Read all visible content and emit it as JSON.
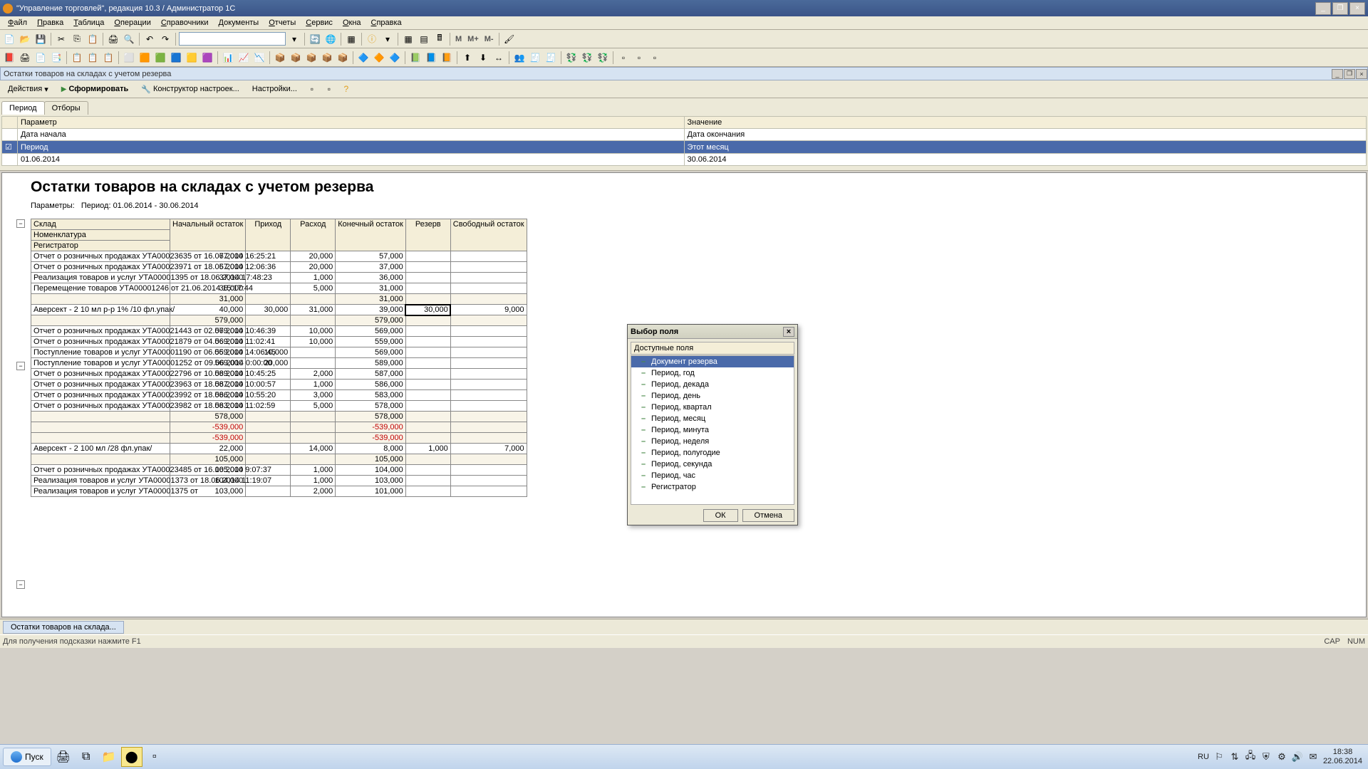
{
  "title": "\"Управление торговлей\", редакция 10.3 / Администратор 1С",
  "menu": [
    "Файл",
    "Правка",
    "Таблица",
    "Операции",
    "Справочники",
    "Документы",
    "Отчеты",
    "Сервис",
    "Окна",
    "Справка"
  ],
  "document_tab": "Остатки товаров на складах с учетом резерва",
  "actionbar": {
    "actions": "Действия",
    "run": "Сформировать",
    "constructor": "Конструктор настроек...",
    "settings": "Настройки..."
  },
  "tabs": [
    "Период",
    "Отборы"
  ],
  "param_headers": {
    "p": "Параметр",
    "v": "Значение"
  },
  "param_rows": [
    {
      "p": "Дата начала",
      "v": "Дата окончания",
      "chk": false
    },
    {
      "p": "Период",
      "v": "Этот месяц",
      "chk": true,
      "sel": true
    },
    {
      "p": "01.06.2014",
      "v": "30.06.2014",
      "chk": false
    }
  ],
  "report": {
    "title": "Остатки товаров на складах с учетом резерва",
    "params_label": "Параметры:",
    "params_value": "Период: 01.06.2014 - 30.06.2014",
    "cols": [
      "Склад",
      "Начальный остаток",
      "Приход",
      "Расход",
      "Конечный остаток",
      "Резерв",
      "Свободный остаток"
    ],
    "sub": [
      "Номенклатура",
      "Регистратор"
    ],
    "rows": [
      {
        "n": "Отчет о розничных продажах УТА00023635 от 16.06.2014 16:25:21",
        "c": [
          "77,000",
          "",
          "20,000",
          "57,000",
          "",
          ""
        ]
      },
      {
        "n": "Отчет о розничных продажах УТА00023971 от 18.06.2014 12:06:36",
        "c": [
          "57,000",
          "",
          "20,000",
          "37,000",
          "",
          ""
        ]
      },
      {
        "n": "Реализация товаров и услуг УТА00001395 от 18.06.2014 17:48:23",
        "c": [
          "37,000",
          "",
          "1,000",
          "36,000",
          "",
          ""
        ]
      },
      {
        "n": "Перемещение товаров УТА00001246 от 21.06.2014 15:17:44",
        "c": [
          "36,000",
          "",
          "5,000",
          "31,000",
          "",
          ""
        ]
      },
      {
        "n": "",
        "c": [
          "31,000",
          "",
          "",
          "31,000",
          "",
          ""
        ],
        "grp": true
      },
      {
        "n": "Аверсект - 2 10 мл р-р 1% /10 фл.упак/",
        "c": [
          "40,000",
          "30,000",
          "31,000",
          "39,000",
          "30,000",
          "9,000"
        ],
        "sel": 4
      },
      {
        "n": "",
        "c": [
          "579,000",
          "",
          "",
          "579,000",
          "",
          ""
        ],
        "grp": true
      },
      {
        "n": "Отчет о розничных продажах УТА00021443 от 02.06.2014 10:46:39",
        "c": [
          "579,000",
          "",
          "10,000",
          "569,000",
          "",
          ""
        ]
      },
      {
        "n": "Отчет о розничных продажах УТА00021879 от 04.06.2014 11:02:41",
        "c": [
          "569,000",
          "",
          "10,000",
          "559,000",
          "",
          ""
        ]
      },
      {
        "n": "Поступление товаров и услуг УТА00001190 от 06.06.2014 14:06:45",
        "c": [
          "559,000",
          "10,000",
          "",
          "569,000",
          "",
          ""
        ]
      },
      {
        "n": "Поступление товаров и услуг УТА00001252 от 09.06.2014 0:00:00",
        "c": [
          "569,000",
          "20,000",
          "",
          "589,000",
          "",
          ""
        ]
      },
      {
        "n": "Отчет о розничных продажах УТА00022796 от 10.06.2014 10:45:25",
        "c": [
          "589,000",
          "",
          "2,000",
          "587,000",
          "",
          ""
        ]
      },
      {
        "n": "Отчет о розничных продажах УТА00023963 от 18.06.2014 10:00:57",
        "c": [
          "587,000",
          "",
          "1,000",
          "586,000",
          "",
          ""
        ]
      },
      {
        "n": "Отчет о розничных продажах УТА00023992 от 18.06.2014 10:55:20",
        "c": [
          "586,000",
          "",
          "3,000",
          "583,000",
          "",
          ""
        ]
      },
      {
        "n": "Отчет о розничных продажах УТА00023982 от 18.06.2014 11:02:59",
        "c": [
          "583,000",
          "",
          "5,000",
          "578,000",
          "",
          ""
        ]
      },
      {
        "n": "",
        "c": [
          "578,000",
          "",
          "",
          "578,000",
          "",
          ""
        ],
        "grp": true
      },
      {
        "n": "",
        "c": [
          "-539,000",
          "",
          "",
          "-539,000",
          "",
          ""
        ],
        "grp": true,
        "neg": true
      },
      {
        "n": "",
        "c": [
          "-539,000",
          "",
          "",
          "-539,000",
          "",
          ""
        ],
        "grp": true,
        "neg": true
      },
      {
        "n": "Аверсект - 2 100 мл /28 фл.упак/",
        "c": [
          "22,000",
          "",
          "14,000",
          "8,000",
          "1,000",
          "7,000"
        ]
      },
      {
        "n": "",
        "c": [
          "105,000",
          "",
          "",
          "105,000",
          "",
          ""
        ],
        "grp": true
      },
      {
        "n": "Отчет о розничных продажах УТА00023485 от 16.06.2014 9:07:37",
        "c": [
          "105,000",
          "",
          "1,000",
          "104,000",
          "",
          ""
        ]
      },
      {
        "n": "Реализация товаров и услуг УТА00001373 от 18.06.2014 11:19:07",
        "c": [
          "104,000",
          "",
          "1,000",
          "103,000",
          "",
          ""
        ]
      },
      {
        "n": "Реализация товаров и услуг УТА00001375 от",
        "c": [
          "103,000",
          "",
          "2,000",
          "101,000",
          "",
          ""
        ]
      }
    ]
  },
  "dialog": {
    "title": "Выбор поля",
    "header": "Доступные поля",
    "items": [
      "Документ резерва",
      "Период, год",
      "Период, декада",
      "Период, день",
      "Период, квартал",
      "Период, месяц",
      "Период, минута",
      "Период, неделя",
      "Период, полугодие",
      "Период, секунда",
      "Период, час",
      "Регистратор"
    ],
    "ok": "ОК",
    "cancel": "Отмена"
  },
  "bottom_tab": "Остатки товаров на склада...",
  "status": "Для получения подсказки нажмите F1",
  "status_right": {
    "cap": "CAP",
    "num": "NUM"
  },
  "start": "Пуск",
  "lang": "RU",
  "clock": {
    "time": "18:38",
    "date": "22.06.2014"
  }
}
